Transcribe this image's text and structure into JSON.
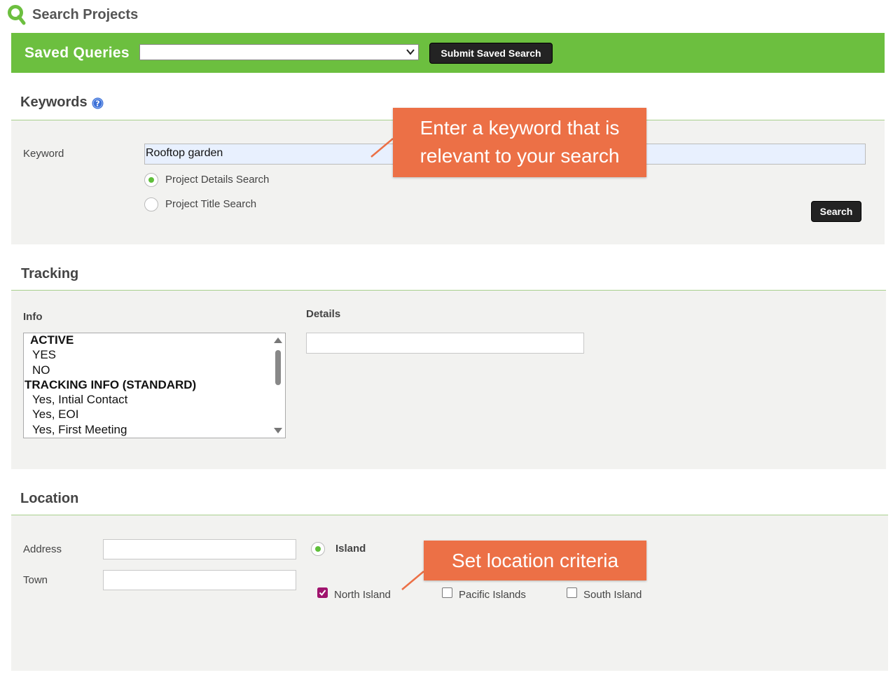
{
  "header": {
    "title": "Search Projects",
    "logo_icon": "magnifier-logo-icon"
  },
  "saved_queries": {
    "label": "Saved Queries",
    "selected_value": "",
    "submit_label": "Submit Saved Search"
  },
  "keywords": {
    "title": "Keywords",
    "help_icon": "question-icon",
    "keyword_label": "Keyword",
    "keyword_value": "Rooftop garden",
    "radio_details_label": "Project Details Search",
    "radio_details_selected": true,
    "radio_title_label": "Project Title Search",
    "radio_title_selected": false,
    "search_label": "Search"
  },
  "tracking": {
    "title": "Tracking",
    "info_label": "Info",
    "details_label": "Details",
    "details_value": "",
    "info_options": [
      {
        "text": "ACTIVE",
        "group": true
      },
      {
        "text": "YES",
        "group": false
      },
      {
        "text": "NO",
        "group": false
      },
      {
        "text": "TRACKING INFO (STANDARD)",
        "group": true
      },
      {
        "text": "Yes, Intial Contact",
        "group": false
      },
      {
        "text": "Yes, EOI",
        "group": false
      },
      {
        "text": "Yes, First Meeting",
        "group": false
      }
    ]
  },
  "location": {
    "title": "Location",
    "address_label": "Address",
    "address_value": "",
    "town_label": "Town",
    "town_value": "",
    "island_label": "Island",
    "island_selected": true,
    "checkboxes": [
      {
        "label": "North Island",
        "checked": true
      },
      {
        "label": "Pacific Islands",
        "checked": false
      },
      {
        "label": "South Island",
        "checked": false
      }
    ]
  },
  "callouts": {
    "keyword_line1": "Enter a keyword that is",
    "keyword_line2": "relevant to your search",
    "location": "Set location criteria"
  },
  "colors": {
    "brand_green": "#6cbf3f",
    "callout_orange": "#ec7046",
    "checkbox_checked": "#a0146e",
    "button_dark": "#232323"
  }
}
